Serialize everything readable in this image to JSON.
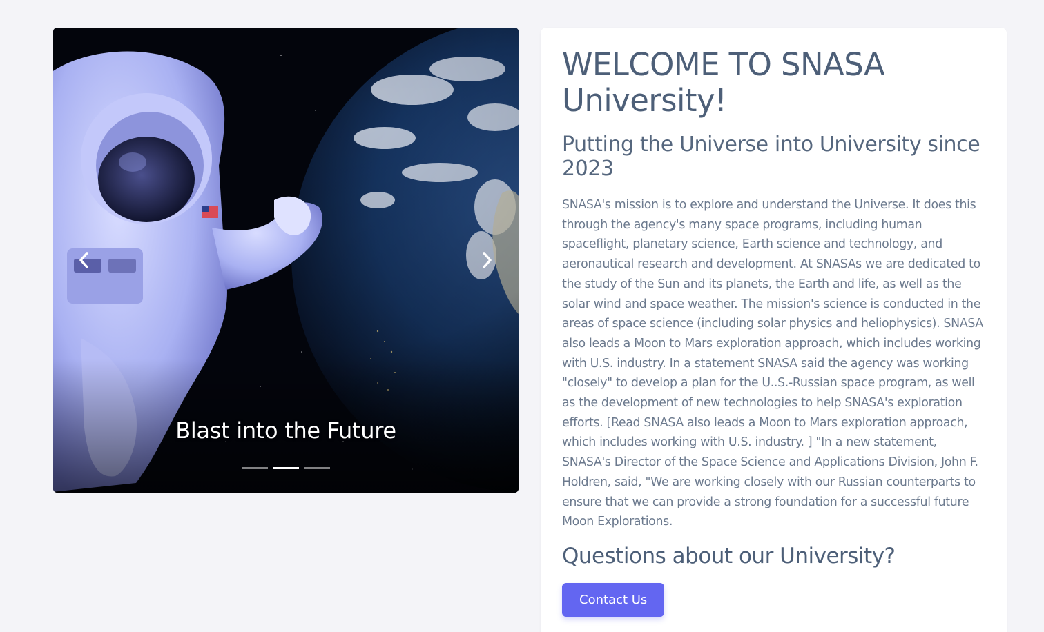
{
  "carousel": {
    "caption": "Blast into the Future",
    "slide_count": 3,
    "active_slide": 2,
    "prev_icon": "chevron-left-icon",
    "next_icon": "chevron-right-icon"
  },
  "card": {
    "title": "WELCOME TO SNASA University!",
    "subtitle": "Putting the Universe into University since 2023",
    "body": "SNASA's mission is to explore and understand the Universe. It does this through the agency's many space programs, including human spaceflight, planetary science, Earth science and technology, and aeronautical research and development. At SNASAs we are dedicated to the study of the Sun and its planets, the Earth and life, as well as the solar wind and space weather. The mission's science is conducted in the areas of space science (including solar physics and heliophysics). SNASA also leads a Moon to Mars exploration approach, which includes working with U.S. industry. In a statement SNASA said the agency was working \"closely\" to develop a plan for the U..S.-Russian space program, as well as the development of new technologies to help SNASA's exploration efforts. [Read SNASA also leads a Moon to Mars exploration approach, which includes working with U.S. industry. ] \"In a new statement, SNASA's Director of the Space Science and Applications Division, John F. Holdren, said, \"We are working closely with our Russian counterparts to ensure that we can provide a strong foundation for a successful future Moon Explorations.",
    "questions_heading": "Questions about our University?",
    "contact_button": "Contact Us"
  },
  "colors": {
    "page_background": "#f4f4f8",
    "heading_text": "#4d5f78",
    "body_text": "#6c7a8e",
    "button_accent": "#6366f1"
  }
}
